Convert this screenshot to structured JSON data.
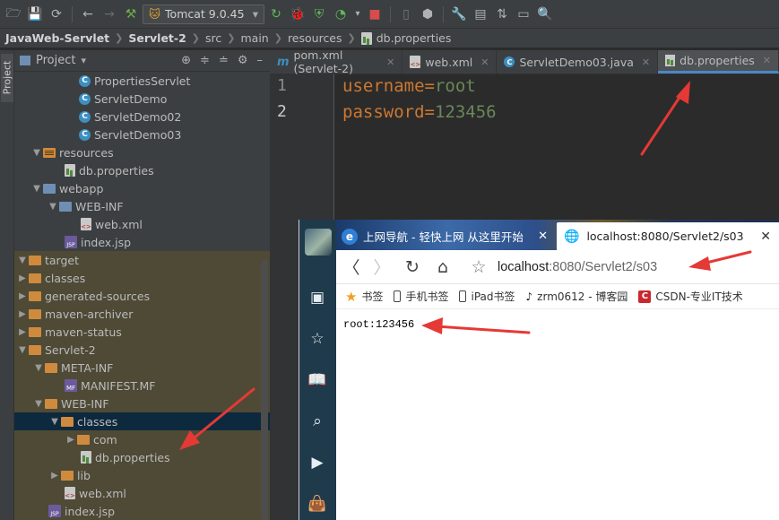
{
  "toolbar": {
    "run_config": "Tomcat 9.0.45"
  },
  "breadcrumb": {
    "items": [
      "JavaWeb-Servlet",
      "Servlet-2",
      "src",
      "main",
      "resources",
      "db.properties"
    ]
  },
  "side_strip": {
    "label": "Project"
  },
  "project_panel": {
    "title": "Project",
    "tree": [
      {
        "label": "PropertiesServlet",
        "icon": "class"
      },
      {
        "label": "ServletDemo",
        "icon": "class"
      },
      {
        "label": "ServletDemo02",
        "icon": "class"
      },
      {
        "label": "ServletDemo03",
        "icon": "class"
      },
      {
        "label": "resources",
        "icon": "resources-folder"
      },
      {
        "label": "db.properties",
        "icon": "properties-file"
      },
      {
        "label": "webapp",
        "icon": "web-folder"
      },
      {
        "label": "WEB-INF",
        "icon": "folder"
      },
      {
        "label": "web.xml",
        "icon": "xml-file"
      },
      {
        "label": "index.jsp",
        "icon": "jsp-file"
      },
      {
        "label": "target",
        "icon": "folder"
      },
      {
        "label": "classes",
        "icon": "folder"
      },
      {
        "label": "generated-sources",
        "icon": "folder"
      },
      {
        "label": "maven-archiver",
        "icon": "folder"
      },
      {
        "label": "maven-status",
        "icon": "folder"
      },
      {
        "label": "Servlet-2",
        "icon": "folder"
      },
      {
        "label": "META-INF",
        "icon": "folder"
      },
      {
        "label": "MANIFEST.MF",
        "icon": "mf-file"
      },
      {
        "label": "WEB-INF",
        "icon": "folder"
      },
      {
        "label": "classes",
        "icon": "folder"
      },
      {
        "label": "com",
        "icon": "folder"
      },
      {
        "label": "db.properties",
        "icon": "properties-file"
      },
      {
        "label": "lib",
        "icon": "folder"
      },
      {
        "label": "web.xml",
        "icon": "xml-file"
      },
      {
        "label": "index.jsp",
        "icon": "jsp-file"
      }
    ]
  },
  "editor_tabs": [
    {
      "label": "pom.xml (Servlet-2)",
      "icon": "maven-icon",
      "active": false
    },
    {
      "label": "web.xml",
      "icon": "xml-icon",
      "active": false
    },
    {
      "label": "ServletDemo03.java",
      "icon": "class-icon",
      "active": false
    },
    {
      "label": "db.properties",
      "icon": "properties-icon",
      "active": true
    }
  ],
  "editor": {
    "line_numbers": [
      "1",
      "2"
    ],
    "lines": [
      {
        "key": "username",
        "eq": "=",
        "value": "root"
      },
      {
        "key": "password",
        "eq": "=",
        "value": "123456"
      }
    ]
  },
  "browser": {
    "tab1": {
      "title": "上网导航 - 轻快上网 从这里开始"
    },
    "tab2": {
      "title": "localhost:8080/Servlet2/s03"
    },
    "url_host": "localhost",
    "url_path": ":8080/Servlet2/s03",
    "bookmarks": [
      {
        "label": "书签",
        "icon": "star-icon"
      },
      {
        "label": "手机书签",
        "icon": "phone-icon"
      },
      {
        "label": "iPad书签",
        "icon": "phone-icon"
      },
      {
        "label": "zrm0612 - 博客园",
        "icon": "blog-icon"
      },
      {
        "label": "CSDN-专业IT技术",
        "icon": "csdn-icon"
      }
    ],
    "output": "root:123456"
  },
  "colors": {
    "arrow": "#e53935",
    "accent": "#4a88c7"
  }
}
